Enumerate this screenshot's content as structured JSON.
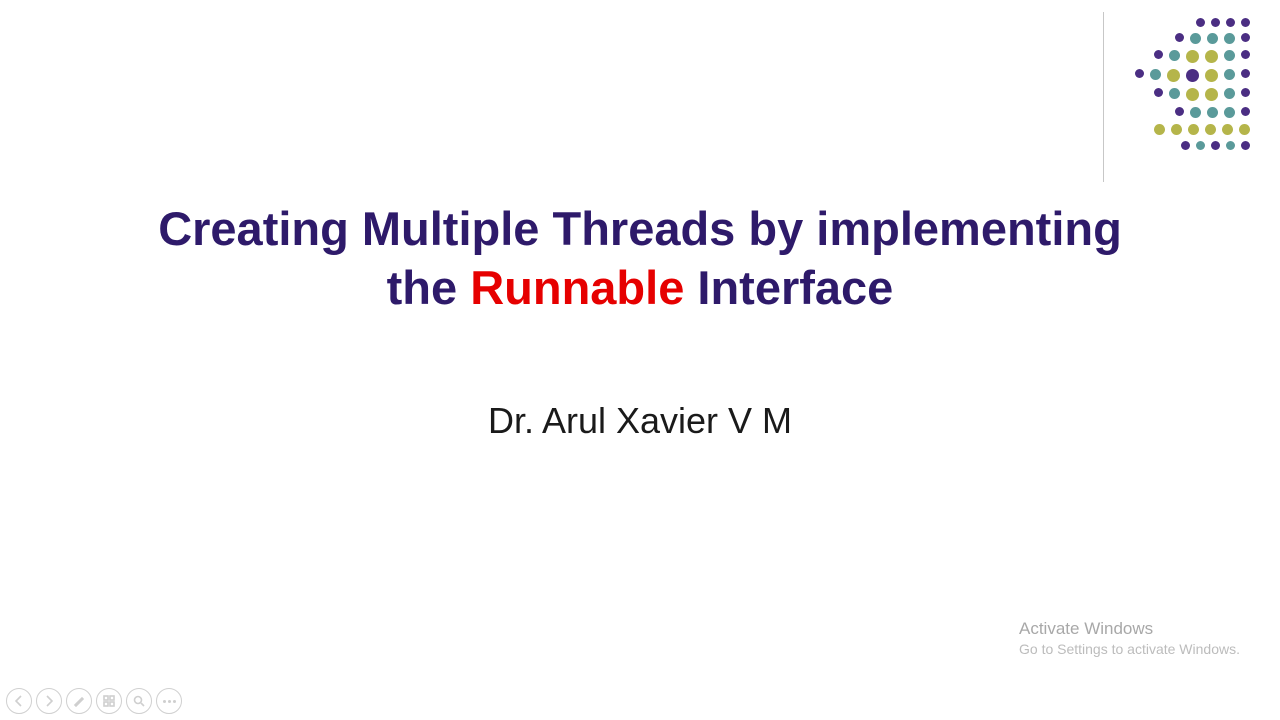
{
  "title": {
    "line1": "Creating Multiple Threads by implementing",
    "line2_pre": "the ",
    "line2_highlight": "Runnable",
    "line2_post": " Interface"
  },
  "author": "Dr. Arul Xavier V M",
  "watermark": {
    "line1": "Activate Windows",
    "line2": "Go to Settings to activate Windows."
  },
  "colors": {
    "title": "#2e1a6a",
    "highlight": "#e60000"
  }
}
